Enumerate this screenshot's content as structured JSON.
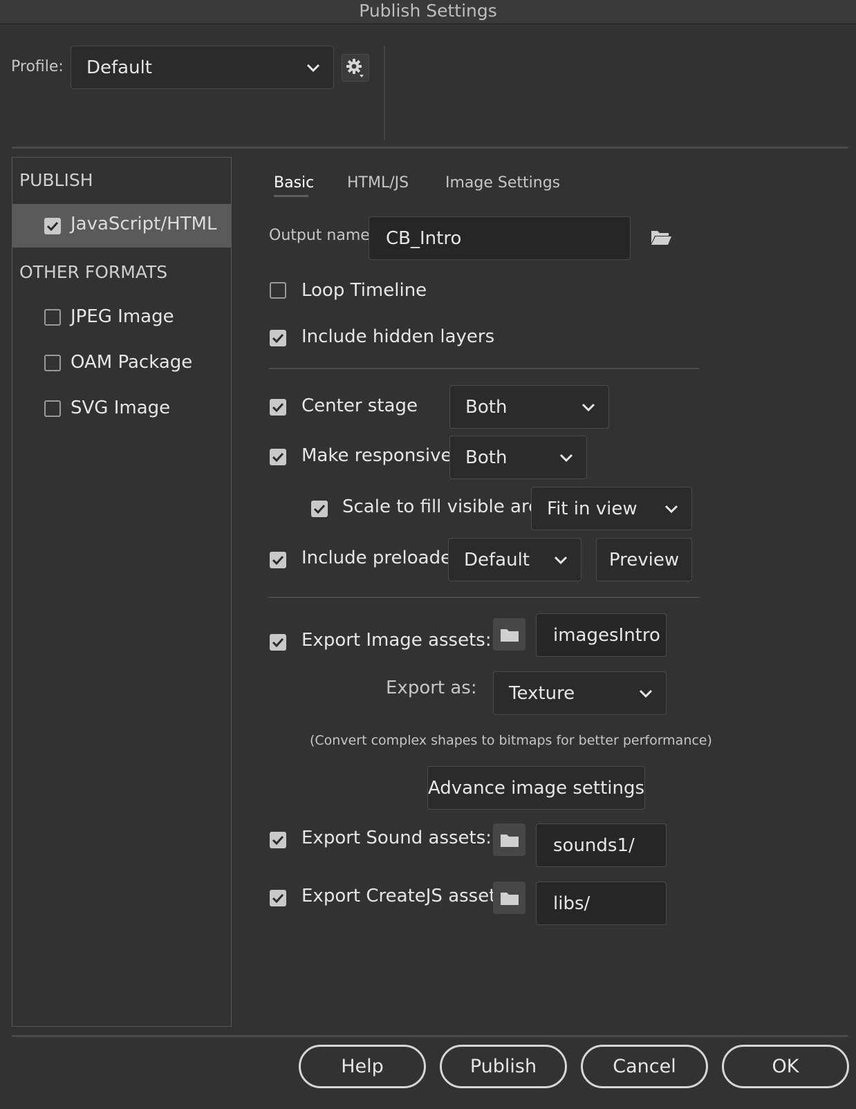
{
  "window": {
    "title": "Publish Settings"
  },
  "profile": {
    "label": "Profile:",
    "value": "Default",
    "gear_icon": "gear-icon"
  },
  "sidebar": {
    "publish_heading": "PUBLISH",
    "publish_items": [
      {
        "label": "JavaScript/HTML",
        "checked": true
      }
    ],
    "other_heading": "OTHER FORMATS",
    "other_items": [
      {
        "label": "JPEG Image",
        "checked": false
      },
      {
        "label": "OAM Package",
        "checked": false
      },
      {
        "label": "SVG Image",
        "checked": false
      }
    ]
  },
  "tabs": [
    {
      "label": "Basic",
      "active": true
    },
    {
      "label": "HTML/JS",
      "active": false
    },
    {
      "label": "Image Settings",
      "active": false
    }
  ],
  "basic": {
    "output_name_label": "Output name:",
    "output_name_value": "CB_Intro",
    "loop_timeline": {
      "label": "Loop Timeline",
      "checked": false
    },
    "include_hidden_layers": {
      "label": "Include hidden layers",
      "checked": true
    },
    "center_stage": {
      "label": "Center stage",
      "checked": true,
      "value": "Both"
    },
    "make_responsive": {
      "label": "Make responsive",
      "checked": true,
      "value": "Both"
    },
    "scale_to_fill": {
      "label": "Scale to fill visible area",
      "checked": true,
      "value": "Fit in view"
    },
    "include_preloader": {
      "label": "Include preloader",
      "checked": true,
      "value": "Default",
      "preview_label": "Preview"
    },
    "export_image_assets": {
      "label": "Export Image assets:",
      "checked": true,
      "path": "imagesIntro"
    },
    "export_as": {
      "label": "Export as:",
      "value": "Texture"
    },
    "convert_note": "(Convert complex shapes to bitmaps for better performance)",
    "advance_image_settings_label": "Advance image settings",
    "export_sound_assets": {
      "label": "Export Sound assets:",
      "checked": true,
      "path": "sounds1/"
    },
    "export_createjs_assets": {
      "label": "Export CreateJS assets:",
      "checked": true,
      "path": "libs/"
    }
  },
  "footer": {
    "help": "Help",
    "publish": "Publish",
    "cancel": "Cancel",
    "ok": "OK"
  },
  "colors": {
    "background": "#323232",
    "field": "#262626",
    "selected": "#5a5a5a",
    "checkbox": "#c9c9c9"
  }
}
